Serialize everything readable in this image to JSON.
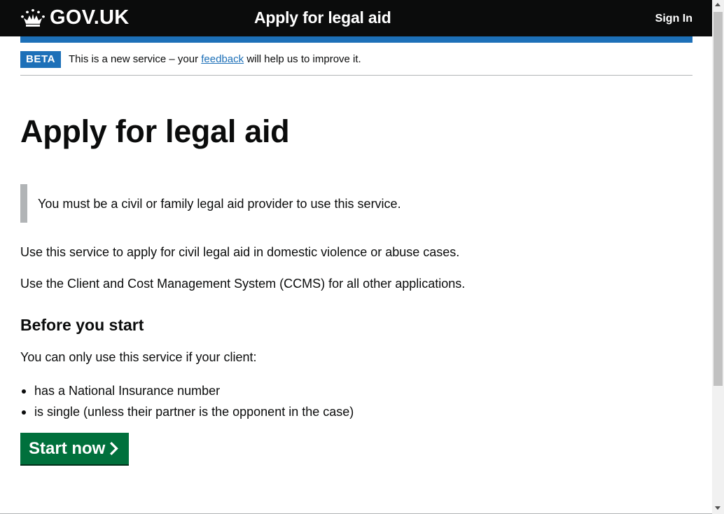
{
  "header": {
    "logo_text": "GOV.UK",
    "logo_icon": "crown-icon",
    "service_name": "Apply for legal aid",
    "sign_in_label": "Sign In"
  },
  "phase_banner": {
    "tag": "BETA",
    "text_before": "This is a new service – your",
    "link": "feedback",
    "text_after": "will help us to improve it."
  },
  "main": {
    "title": "Apply for legal aid",
    "inset_text": "You must be a civil or family legal aid provider to use this service.",
    "paragraph_1": "Use this service to apply for civil legal aid in domestic violence or abuse cases.",
    "paragraph_2": "Use the Client and Cost Management System (CCMS) for all other applications.",
    "heading": "Before you start",
    "paragraph_3": "You can only use this service if your client:",
    "list": [
      "has a National Insurance number",
      "is single (unless their partner is the opponent in the case)"
    ],
    "start_button_label": "Start now",
    "start_button_icon": "chevron-right-icon"
  },
  "colors": {
    "header_bg": "#0b0c0c",
    "brand_blue": "#1d70b8",
    "button_green": "#00703c",
    "inset_border": "#b1b4b6",
    "text": "#0b0c0c"
  }
}
